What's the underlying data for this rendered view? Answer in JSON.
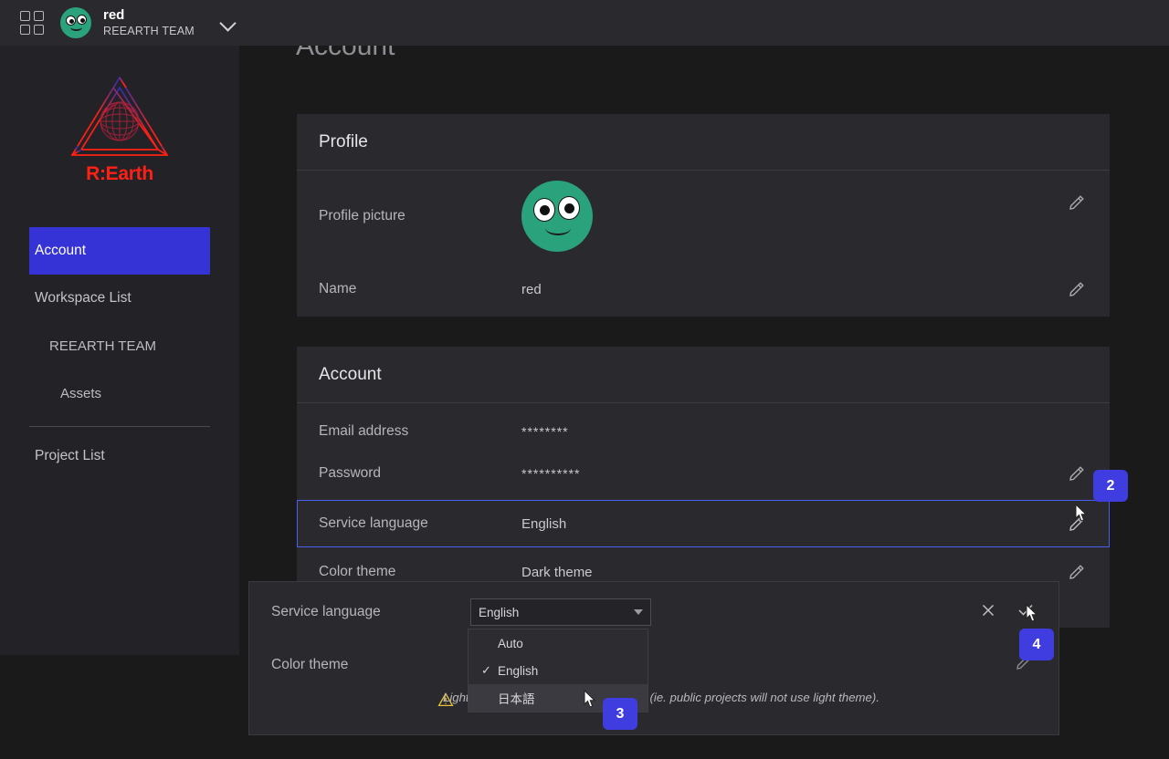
{
  "topbar": {
    "grid_icon": "apps-grid-icon",
    "workspace_name": "red",
    "workspace_team": "REEARTH TEAM",
    "chevron_icon": "chevron-down-icon"
  },
  "sidebar": {
    "logo_text": "R:Earth",
    "logo_icon": "reearth-penrose-globe-logo",
    "items": [
      {
        "label": "Account",
        "level": 0,
        "active": true
      },
      {
        "label": "Workspace List",
        "level": 0,
        "active": false
      },
      {
        "label": "REEARTH TEAM",
        "level": 1,
        "active": false
      },
      {
        "label": "Assets",
        "level": 2,
        "active": false
      },
      {
        "label": "Project List",
        "level": 0,
        "active": false
      }
    ]
  },
  "main": {
    "page_title": "Account",
    "profile_card": {
      "title": "Profile",
      "rows": [
        {
          "label": "Profile picture",
          "value": "",
          "has_avatar": true,
          "editable": true
        },
        {
          "label": "Name",
          "value": "red",
          "has_avatar": false,
          "editable": true
        }
      ]
    },
    "account_card": {
      "title": "Account",
      "rows": [
        {
          "label": "Email address",
          "value": "********",
          "editable": false,
          "selected": false
        },
        {
          "label": "Password",
          "value": "**********",
          "editable": true,
          "selected": false
        },
        {
          "label": "Service language",
          "value": "English",
          "editable": true,
          "selected": true
        },
        {
          "label": "Color theme",
          "value": "Dark theme",
          "editable": true,
          "selected": false
        }
      ]
    }
  },
  "overlay": {
    "service_language_label": "Service language",
    "select_value": "English",
    "color_theme_label": "Color theme",
    "close_icon": "close-x-icon",
    "confirm_icon": "check-icon",
    "warning_icon": "warning-triangle-icon",
    "note": "Light theme may still not be supported (ie. public projects will not use light theme).",
    "dropdown": {
      "options": [
        {
          "label": "Auto",
          "checked": false,
          "hovered": false
        },
        {
          "label": "English",
          "checked": true,
          "hovered": false
        },
        {
          "label": "日本語",
          "checked": false,
          "hovered": true
        }
      ],
      "check_glyph": "✓"
    }
  },
  "annotations": {
    "badges": [
      {
        "number": "2"
      },
      {
        "number": "4"
      },
      {
        "number": "3"
      }
    ]
  },
  "colors": {
    "accent_blue": "#3f3ce0",
    "selection_outline": "#4a5ef0",
    "logo_red": "#ff2015",
    "avatar_green": "#2aa37c",
    "card_bg": "#2a2a2e",
    "page_bg": "#1a1a1b",
    "sidebar_bg": "#232327",
    "warning_yellow": "#e8c33a"
  }
}
